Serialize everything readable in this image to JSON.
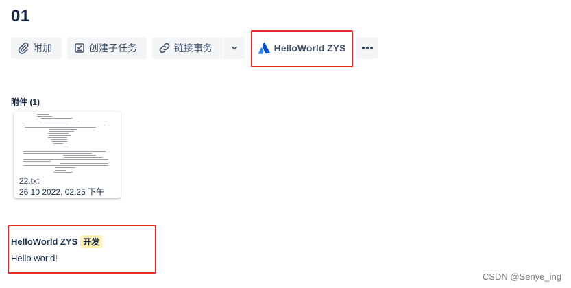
{
  "issue": {
    "title": "01"
  },
  "toolbar": {
    "attach_label": "附加",
    "create_subtask_label": "创建子任务",
    "link_issue_label": "链接事务",
    "helloworld_label": "HelloWorld ZYS",
    "icons": {
      "attach": "paperclip-icon",
      "subtask": "checkbox-list-icon",
      "link": "link-icon",
      "dropdown": "chevron-down-icon",
      "helloworld": "atlassian-logo-icon",
      "more": "more-horizontal-icon"
    }
  },
  "attachments": {
    "heading": "附件",
    "count": "(1)",
    "items": [
      {
        "filename": "22.txt",
        "date": "26 10 2022, 02:25 下午"
      }
    ]
  },
  "panel": {
    "title": "HelloWorld ZYS",
    "badge": "开发",
    "body": "Hello world!"
  },
  "watermark": "CSDN @Senye_ing",
  "colors": {
    "highlight": "#e22b25",
    "button_bg": "#f4f5f7",
    "text": "#172b4d",
    "badge_bg": "#fff0b3",
    "atlassian_blue": "#2684ff"
  }
}
